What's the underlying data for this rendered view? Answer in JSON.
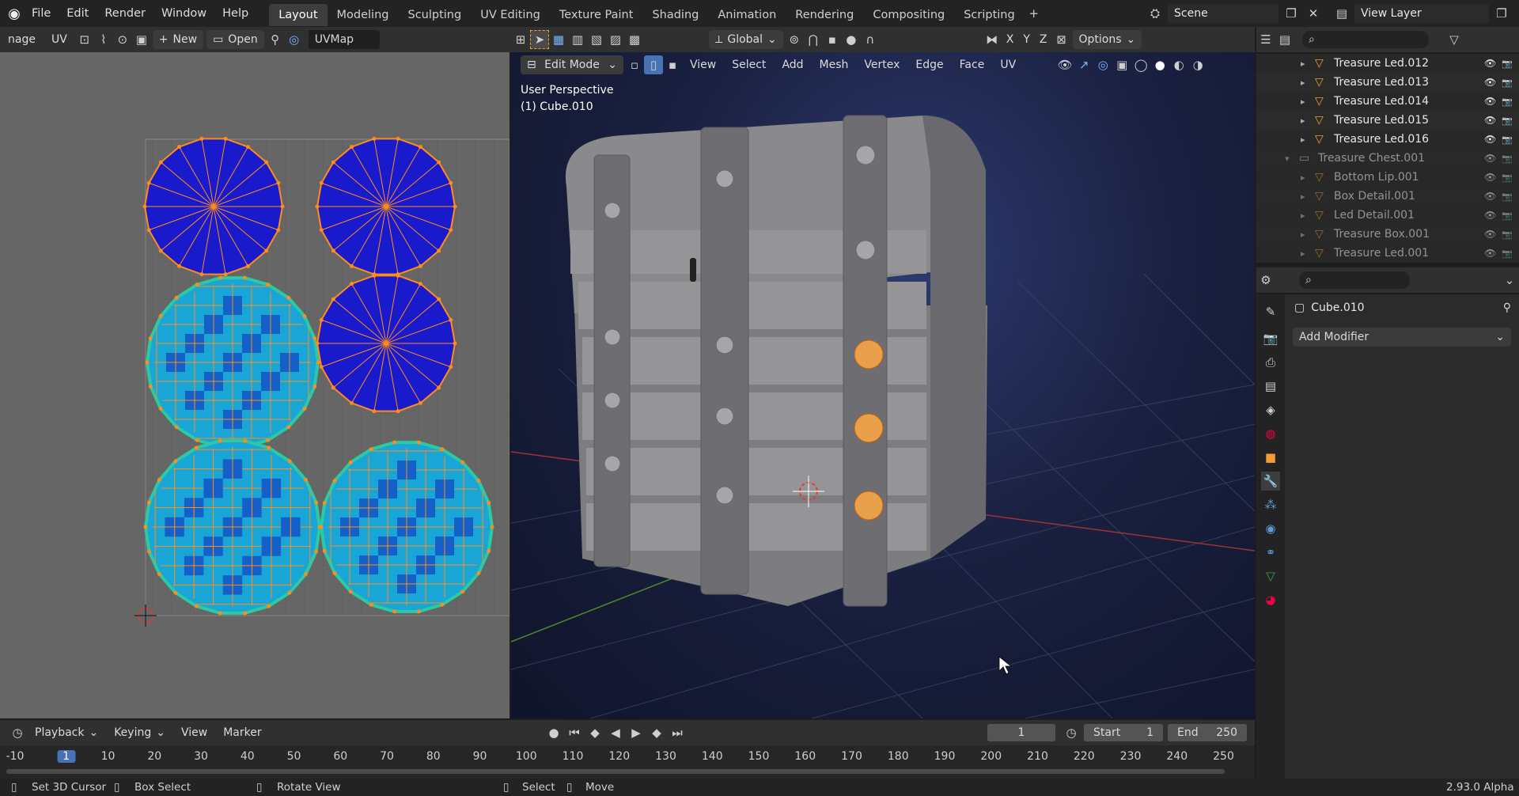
{
  "menu": {
    "file": "File",
    "edit": "Edit",
    "render": "Render",
    "window": "Window",
    "help": "Help"
  },
  "workspaces": [
    "Layout",
    "Modeling",
    "Sculpting",
    "UV Editing",
    "Texture Paint",
    "Shading",
    "Animation",
    "Rendering",
    "Compositing",
    "Scripting"
  ],
  "scene": {
    "label": "Scene",
    "view_layer": "View Layer"
  },
  "uv_editor": {
    "image_menu": "nage",
    "uv_menu": "UV",
    "new_label": "New",
    "open_label": "Open",
    "uvmap": "UVMap"
  },
  "viewport": {
    "mode": "Edit Mode",
    "menus": [
      "View",
      "Select",
      "Add",
      "Mesh",
      "Vertex",
      "Edge",
      "Face",
      "UV"
    ],
    "orientation": "Global",
    "axes": [
      "X",
      "Y",
      "Z"
    ],
    "options": "Options",
    "perspective": "User Perspective",
    "object": "(1) Cube.010"
  },
  "outliner": {
    "items": [
      {
        "name": "Treasure Led.012",
        "dim": false
      },
      {
        "name": "Treasure Led.013",
        "dim": false
      },
      {
        "name": "Treasure Led.014",
        "dim": false
      },
      {
        "name": "Treasure Led.015",
        "dim": false
      },
      {
        "name": "Treasure Led.016",
        "dim": false
      },
      {
        "name": "Treasure Chest.001",
        "dim": true,
        "collection": true
      },
      {
        "name": "Bottom Lip.001",
        "dim": true
      },
      {
        "name": "Box Detail.001",
        "dim": true
      },
      {
        "name": "Led Detail.001",
        "dim": true
      },
      {
        "name": "Treasure Box.001",
        "dim": true
      },
      {
        "name": "Treasure Led.001",
        "dim": true
      }
    ]
  },
  "properties": {
    "object": "Cube.010",
    "add_modifier": "Add Modifier"
  },
  "timeline": {
    "menus": [
      "Playback",
      "Keying",
      "View",
      "Marker"
    ],
    "current_frame": "1",
    "start_label": "Start",
    "start": "1",
    "end_label": "End",
    "end": "250",
    "ticks": [
      "-10",
      "1",
      "10",
      "20",
      "30",
      "40",
      "50",
      "60",
      "70",
      "80",
      "90",
      "100",
      "110",
      "120",
      "130",
      "140",
      "150",
      "160",
      "170",
      "180",
      "190",
      "200",
      "210",
      "220",
      "230",
      "240",
      "250"
    ]
  },
  "status": {
    "set_cursor": "Set 3D Cursor",
    "box_select": "Box Select",
    "rotate": "Rotate View",
    "select": "Select",
    "move": "Move",
    "version": "2.93.0 Alpha"
  }
}
